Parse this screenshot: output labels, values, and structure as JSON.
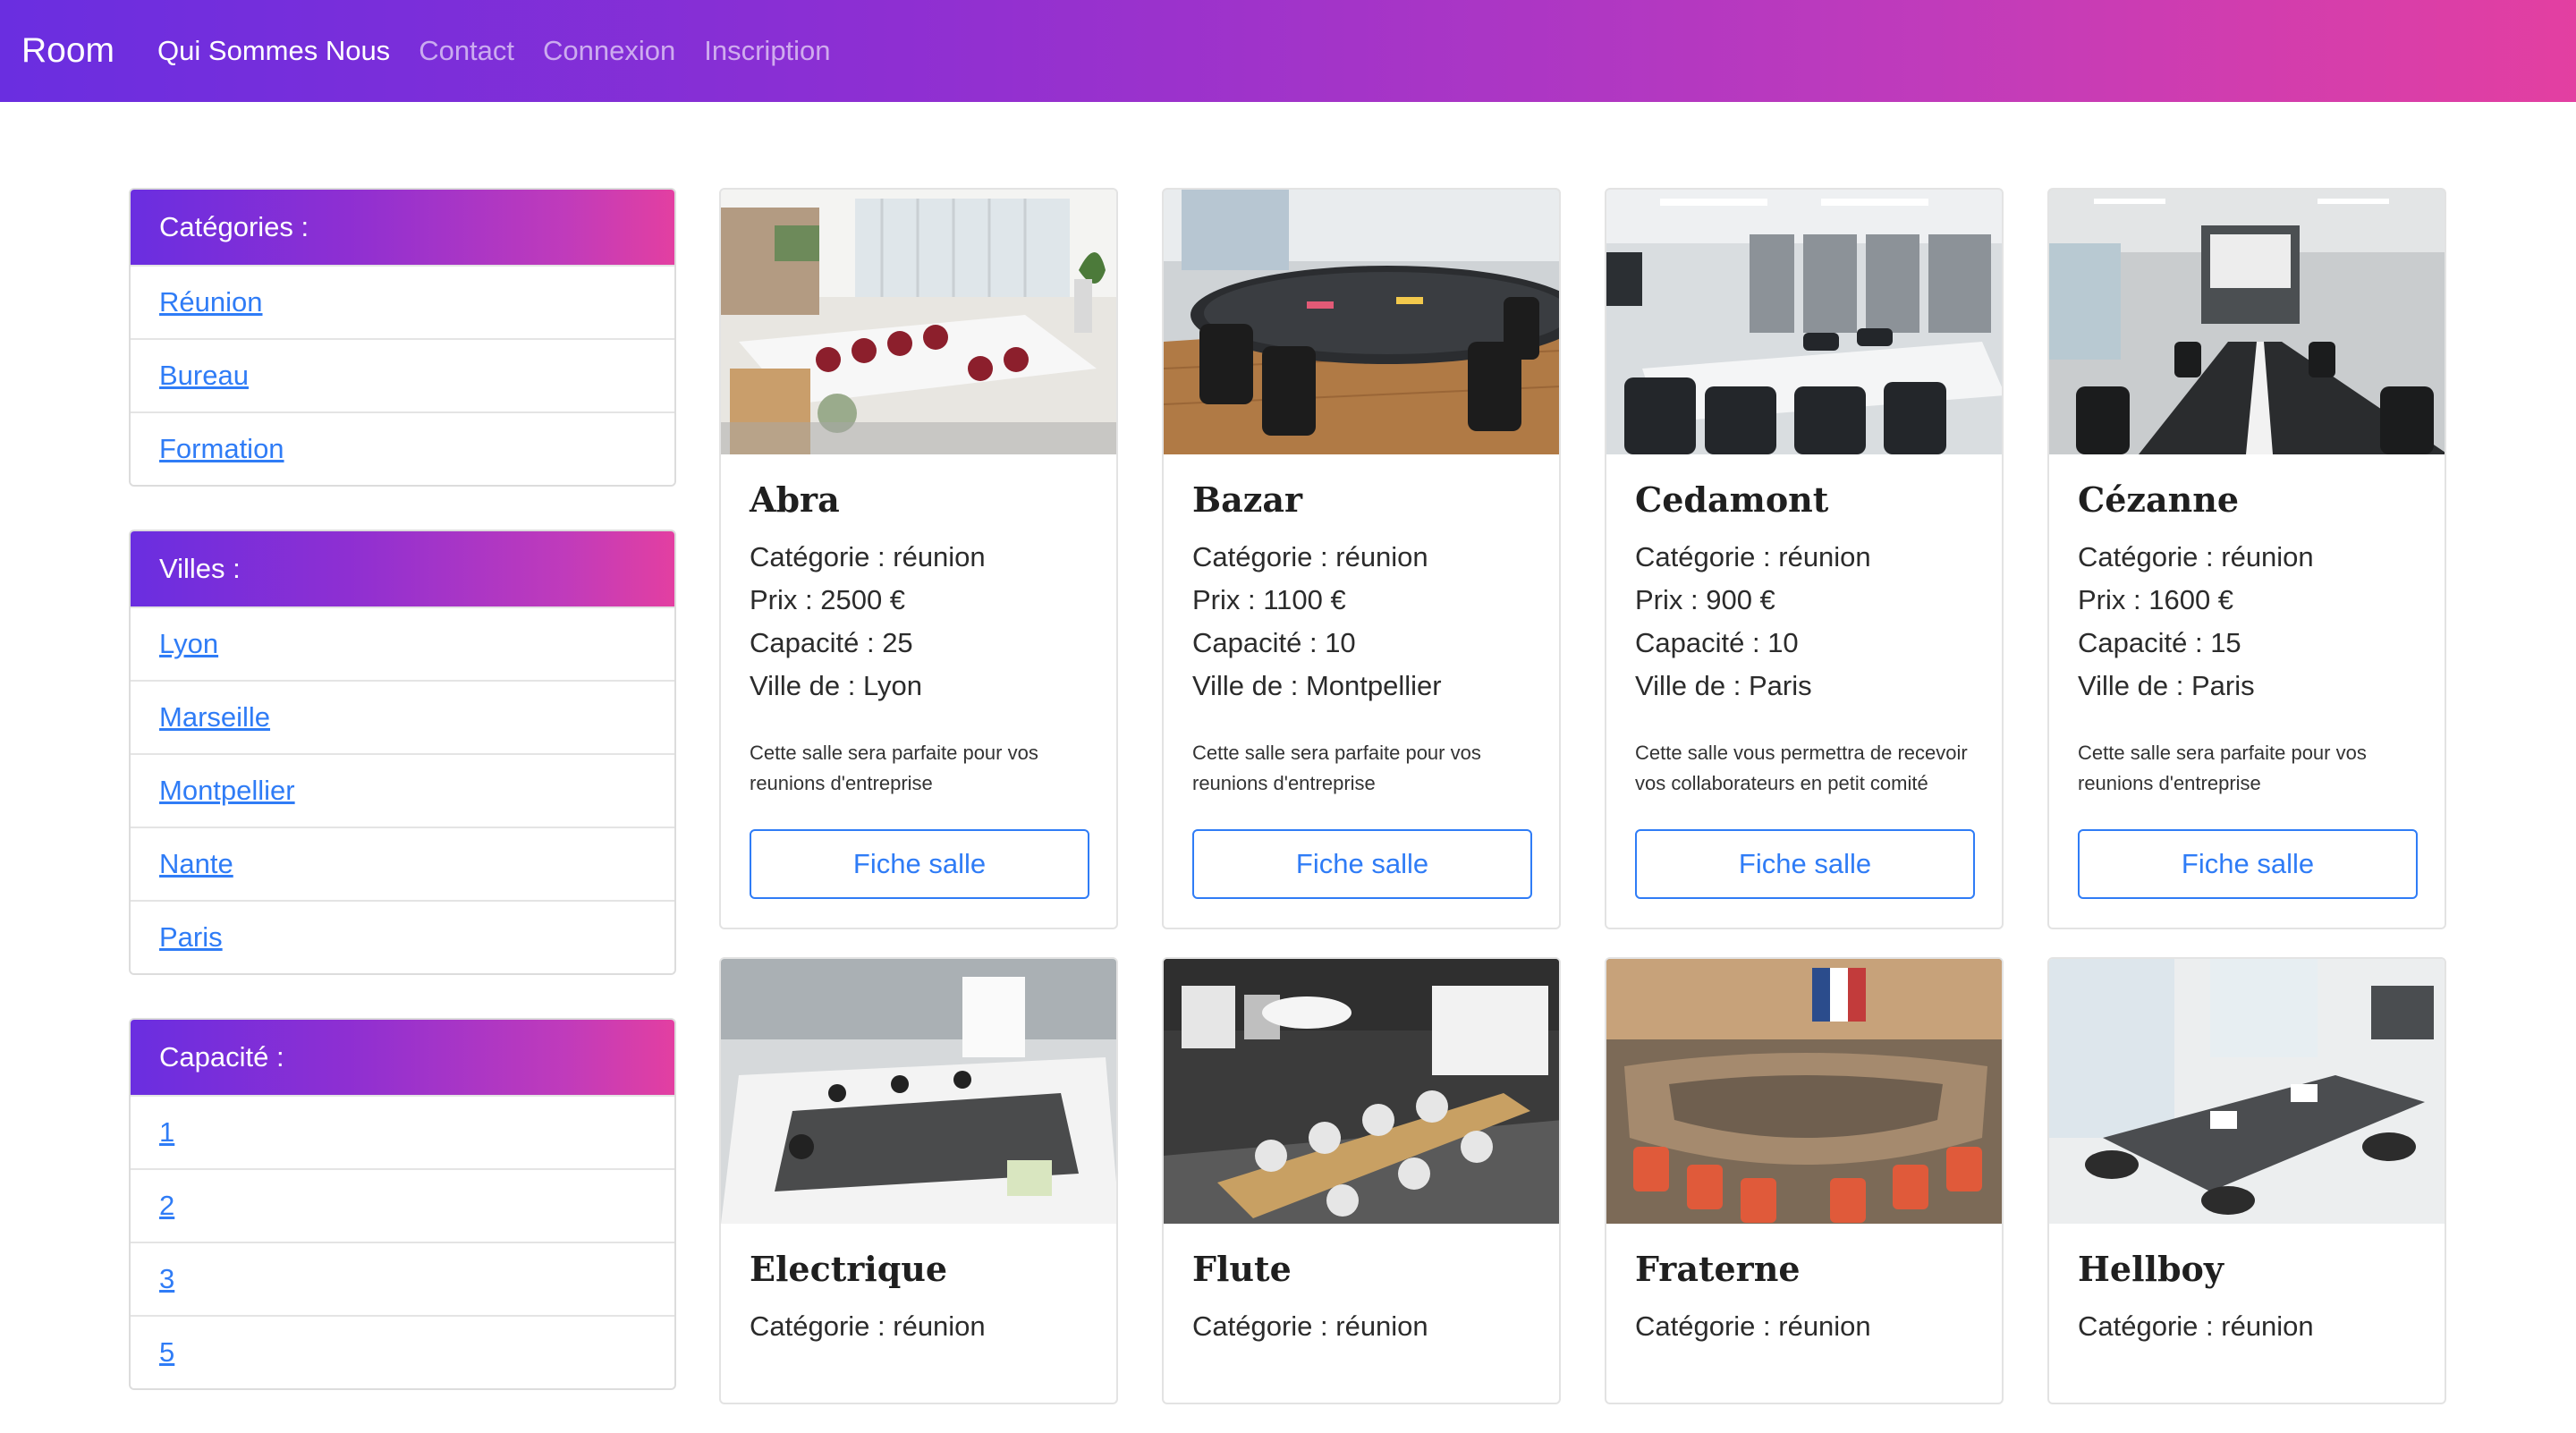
{
  "navbar": {
    "brand": "Room",
    "links": [
      {
        "label": "Qui Sommes Nous",
        "active": true
      },
      {
        "label": "Contact",
        "active": false
      },
      {
        "label": "Connexion",
        "active": false
      },
      {
        "label": "Inscription",
        "active": false
      }
    ]
  },
  "sidebar": {
    "categories": {
      "title": "Catégories :",
      "items": [
        "Réunion",
        "Bureau",
        "Formation"
      ]
    },
    "cities": {
      "title": "Villes :",
      "items": [
        "Lyon",
        "Marseille",
        "Montpellier",
        "Nante",
        "Paris"
      ]
    },
    "capacity": {
      "title": "Capacité :",
      "items": [
        "1",
        "2",
        "3",
        "5"
      ]
    }
  },
  "rooms": [
    {
      "name": "Abra",
      "category": "Catégorie : réunion",
      "price": "Prix : 2500 €",
      "capacity": "Capacité : 25",
      "city": "Ville de : Lyon",
      "description": "Cette salle sera parfaite pour vos reunions d'entreprise",
      "button": "Fiche salle"
    },
    {
      "name": "Bazar",
      "category": "Catégorie : réunion",
      "price": "Prix : 1100 €",
      "capacity": "Capacité : 10",
      "city": "Ville de : Montpellier",
      "description": "Cette salle sera parfaite pour vos reunions d'entreprise",
      "button": "Fiche salle"
    },
    {
      "name": "Cedamont",
      "category": "Catégorie : réunion",
      "price": "Prix : 900 €",
      "capacity": "Capacité : 10",
      "city": "Ville de : Paris",
      "description": "Cette salle vous permettra de recevoir vos collaborateurs en petit comité",
      "button": "Fiche salle"
    },
    {
      "name": "Cézanne",
      "category": "Catégorie : réunion",
      "price": "Prix : 1600 €",
      "capacity": "Capacité : 15",
      "city": "Ville de : Paris",
      "description": "Cette salle sera parfaite pour vos reunions d'entreprise",
      "button": "Fiche salle"
    },
    {
      "name": "Electrique",
      "category": "Catégorie : réunion"
    },
    {
      "name": "Flute",
      "category": "Catégorie : réunion"
    },
    {
      "name": "Fraterne",
      "category": "Catégorie : réunion"
    },
    {
      "name": "Hellboy",
      "category": "Catégorie : réunion"
    }
  ],
  "colors": {
    "gradient_start": "#6a2ee0",
    "gradient_end": "#e33fa1",
    "link": "#2f7cf6"
  }
}
